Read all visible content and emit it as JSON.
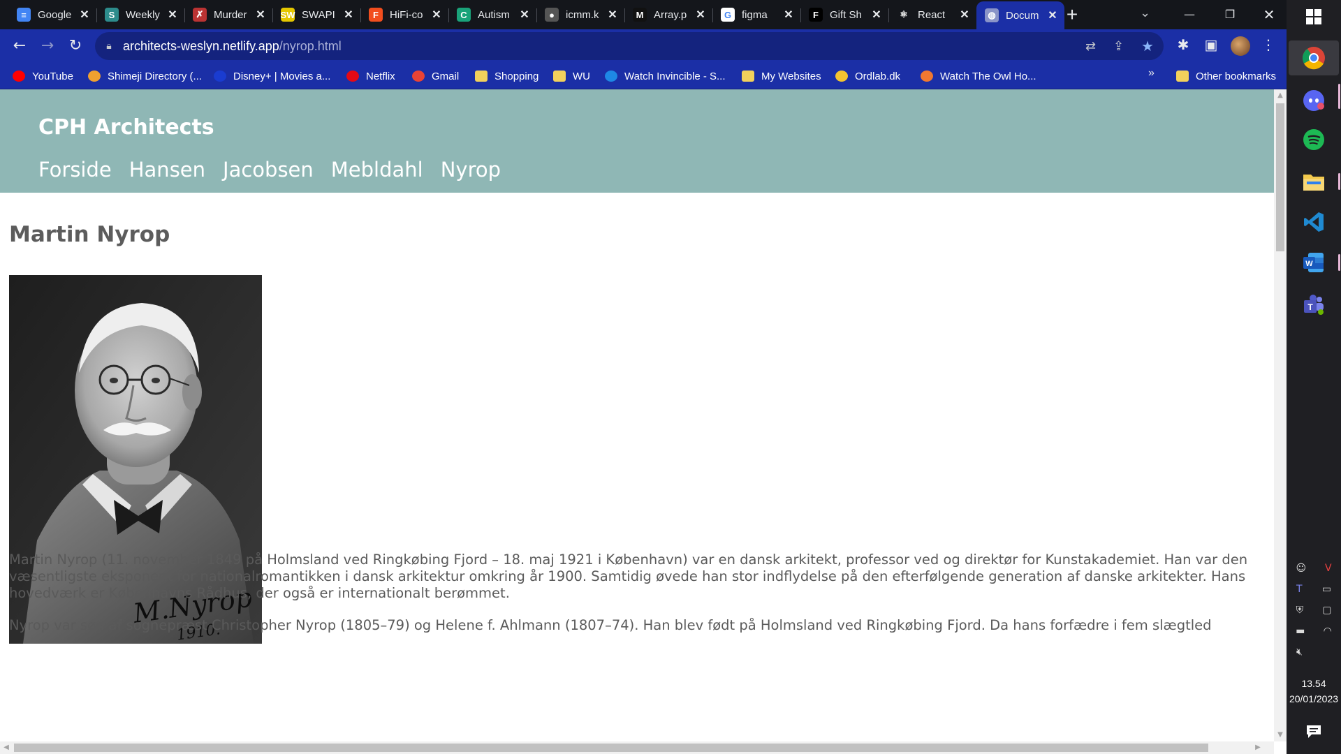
{
  "browser": {
    "tabs": [
      {
        "title": "Google",
        "icon": "google-docs-icon",
        "color": "#4285f4",
        "glyph": "≡"
      },
      {
        "title": "Weekly",
        "icon": "sway-icon",
        "color": "#2d8c8c",
        "glyph": "S"
      },
      {
        "title": "Murder",
        "icon": "murder-icon",
        "color": "#b33",
        "glyph": "✗"
      },
      {
        "title": "SWAPI",
        "icon": "swapi-icon",
        "color": "#e5c700",
        "glyph": "SW"
      },
      {
        "title": "HiFi-co",
        "icon": "figma-icon",
        "color": "#f24e1e",
        "glyph": "F"
      },
      {
        "title": "Autism",
        "icon": "autism-icon",
        "color": "#1aa37a",
        "glyph": "C"
      },
      {
        "title": "icmm.k",
        "icon": "icmm-icon",
        "color": "#555",
        "glyph": "●"
      },
      {
        "title": "Array.p",
        "icon": "mdn-icon",
        "color": "#111",
        "glyph": "M"
      },
      {
        "title": "figma",
        "icon": "google-icon",
        "color": "#ffffff",
        "glyph": "G"
      },
      {
        "title": "Gift Sh",
        "icon": "gift-shop-icon",
        "color": "#000",
        "glyph": "F"
      },
      {
        "title": "React",
        "icon": "react-icon",
        "color": "#14161b",
        "glyph": "⚛"
      },
      {
        "title": "Docum",
        "icon": "globe-icon",
        "color": "#8a94c8",
        "glyph": "◍"
      }
    ],
    "tab_close": "✕",
    "new_tab": "+",
    "url_host": "architects-weslyn.netlify.app",
    "url_path": "/nyrop.html",
    "bookmarks": [
      {
        "label": "YouTube",
        "icon": "youtube-icon",
        "color": "#ff0000"
      },
      {
        "label": "Shimeji Directory (...",
        "icon": "shimeji-icon",
        "color": "#f0a030"
      },
      {
        "label": "Disney+ | Movies a...",
        "icon": "disney-icon",
        "color": "#1a3cd0"
      },
      {
        "label": "Netflix",
        "icon": "netflix-icon",
        "color": "#e50914"
      },
      {
        "label": "Gmail",
        "icon": "gmail-icon",
        "color": "#ea4335"
      },
      {
        "label": "Shopping",
        "icon": "folder-icon",
        "color": "#f2d15c"
      },
      {
        "label": "WU",
        "icon": "folder-icon",
        "color": "#f2d15c"
      },
      {
        "label": "Watch Invincible - S...",
        "icon": "play-icon",
        "color": "#1e88e5"
      },
      {
        "label": "My Websites",
        "icon": "folder-icon",
        "color": "#f2d15c"
      },
      {
        "label": "Ordlab.dk",
        "icon": "ordlab-icon",
        "color": "#f4c430"
      },
      {
        "label": "Watch The Owl Ho...",
        "icon": "owl-house-icon",
        "color": "#f07830"
      }
    ],
    "more_bookmarks": "»",
    "other_bookmarks": "Other bookmarks"
  },
  "site": {
    "title": "CPH Architects",
    "nav": [
      "Forside",
      "Hansen",
      "Jacobsen",
      "Mebldahl",
      "Nyrop"
    ],
    "heading": "Martin Nyrop",
    "portrait_signature": "M.Nyrop 1910",
    "paragraph_1": "Martin Nyrop (11. november 1849 på Holmsland ved Ringkøbing Fjord – 18. maj 1921 i København) var en dansk arkitekt, professor ved og direktør for Kunstakademiet. Han var den væsentligste eksponent for nationalromantikken i dansk arkitektur omkring år 1900. Samtidig øvede han stor indflydelse på den efterfølgende generation af danske arkitekter. Hans hovedværk er Københavns Rådhus, der også er internationalt berømmet.",
    "paragraph_2": "Nyrop var søn af sognepræst Christopher Nyrop (1805–79) og Helene f. Ahlmann (1807–74). Han blev født på Holmsland ved Ringkøbing Fjord. Da hans forfædre i fem slægtled"
  },
  "taskbar": {
    "apps": [
      "chrome-icon",
      "discord-icon",
      "spotify-icon",
      "file-explorer-icon",
      "vscode-icon",
      "word-icon",
      "teams-icon"
    ],
    "time": "13.54",
    "date": "20/01/2023"
  }
}
